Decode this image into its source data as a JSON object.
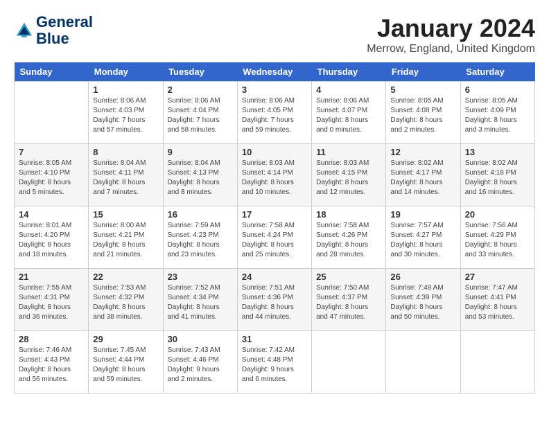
{
  "header": {
    "logo_line1": "General",
    "logo_line2": "Blue",
    "title": "January 2024",
    "subtitle": "Merrow, England, United Kingdom"
  },
  "days_of_week": [
    "Sunday",
    "Monday",
    "Tuesday",
    "Wednesday",
    "Thursday",
    "Friday",
    "Saturday"
  ],
  "weeks": [
    [
      {
        "day": "",
        "info": ""
      },
      {
        "day": "1",
        "info": "Sunrise: 8:06 AM\nSunset: 4:03 PM\nDaylight: 7 hours\nand 57 minutes."
      },
      {
        "day": "2",
        "info": "Sunrise: 8:06 AM\nSunset: 4:04 PM\nDaylight: 7 hours\nand 58 minutes."
      },
      {
        "day": "3",
        "info": "Sunrise: 8:06 AM\nSunset: 4:05 PM\nDaylight: 7 hours\nand 59 minutes."
      },
      {
        "day": "4",
        "info": "Sunrise: 8:06 AM\nSunset: 4:07 PM\nDaylight: 8 hours\nand 0 minutes."
      },
      {
        "day": "5",
        "info": "Sunrise: 8:05 AM\nSunset: 4:08 PM\nDaylight: 8 hours\nand 2 minutes."
      },
      {
        "day": "6",
        "info": "Sunrise: 8:05 AM\nSunset: 4:09 PM\nDaylight: 8 hours\nand 3 minutes."
      }
    ],
    [
      {
        "day": "7",
        "info": "Sunrise: 8:05 AM\nSunset: 4:10 PM\nDaylight: 8 hours\nand 5 minutes."
      },
      {
        "day": "8",
        "info": "Sunrise: 8:04 AM\nSunset: 4:11 PM\nDaylight: 8 hours\nand 7 minutes."
      },
      {
        "day": "9",
        "info": "Sunrise: 8:04 AM\nSunset: 4:13 PM\nDaylight: 8 hours\nand 8 minutes."
      },
      {
        "day": "10",
        "info": "Sunrise: 8:03 AM\nSunset: 4:14 PM\nDaylight: 8 hours\nand 10 minutes."
      },
      {
        "day": "11",
        "info": "Sunrise: 8:03 AM\nSunset: 4:15 PM\nDaylight: 8 hours\nand 12 minutes."
      },
      {
        "day": "12",
        "info": "Sunrise: 8:02 AM\nSunset: 4:17 PM\nDaylight: 8 hours\nand 14 minutes."
      },
      {
        "day": "13",
        "info": "Sunrise: 8:02 AM\nSunset: 4:18 PM\nDaylight: 8 hours\nand 16 minutes."
      }
    ],
    [
      {
        "day": "14",
        "info": "Sunrise: 8:01 AM\nSunset: 4:20 PM\nDaylight: 8 hours\nand 18 minutes."
      },
      {
        "day": "15",
        "info": "Sunrise: 8:00 AM\nSunset: 4:21 PM\nDaylight: 8 hours\nand 21 minutes."
      },
      {
        "day": "16",
        "info": "Sunrise: 7:59 AM\nSunset: 4:23 PM\nDaylight: 8 hours\nand 23 minutes."
      },
      {
        "day": "17",
        "info": "Sunrise: 7:58 AM\nSunset: 4:24 PM\nDaylight: 8 hours\nand 25 minutes."
      },
      {
        "day": "18",
        "info": "Sunrise: 7:58 AM\nSunset: 4:26 PM\nDaylight: 8 hours\nand 28 minutes."
      },
      {
        "day": "19",
        "info": "Sunrise: 7:57 AM\nSunset: 4:27 PM\nDaylight: 8 hours\nand 30 minutes."
      },
      {
        "day": "20",
        "info": "Sunrise: 7:56 AM\nSunset: 4:29 PM\nDaylight: 8 hours\nand 33 minutes."
      }
    ],
    [
      {
        "day": "21",
        "info": "Sunrise: 7:55 AM\nSunset: 4:31 PM\nDaylight: 8 hours\nand 36 minutes."
      },
      {
        "day": "22",
        "info": "Sunrise: 7:53 AM\nSunset: 4:32 PM\nDaylight: 8 hours\nand 38 minutes."
      },
      {
        "day": "23",
        "info": "Sunrise: 7:52 AM\nSunset: 4:34 PM\nDaylight: 8 hours\nand 41 minutes."
      },
      {
        "day": "24",
        "info": "Sunrise: 7:51 AM\nSunset: 4:36 PM\nDaylight: 8 hours\nand 44 minutes."
      },
      {
        "day": "25",
        "info": "Sunrise: 7:50 AM\nSunset: 4:37 PM\nDaylight: 8 hours\nand 47 minutes."
      },
      {
        "day": "26",
        "info": "Sunrise: 7:49 AM\nSunset: 4:39 PM\nDaylight: 8 hours\nand 50 minutes."
      },
      {
        "day": "27",
        "info": "Sunrise: 7:47 AM\nSunset: 4:41 PM\nDaylight: 8 hours\nand 53 minutes."
      }
    ],
    [
      {
        "day": "28",
        "info": "Sunrise: 7:46 AM\nSunset: 4:43 PM\nDaylight: 8 hours\nand 56 minutes."
      },
      {
        "day": "29",
        "info": "Sunrise: 7:45 AM\nSunset: 4:44 PM\nDaylight: 8 hours\nand 59 minutes."
      },
      {
        "day": "30",
        "info": "Sunrise: 7:43 AM\nSunset: 4:46 PM\nDaylight: 9 hours\nand 2 minutes."
      },
      {
        "day": "31",
        "info": "Sunrise: 7:42 AM\nSunset: 4:48 PM\nDaylight: 9 hours\nand 6 minutes."
      },
      {
        "day": "",
        "info": ""
      },
      {
        "day": "",
        "info": ""
      },
      {
        "day": "",
        "info": ""
      }
    ]
  ]
}
